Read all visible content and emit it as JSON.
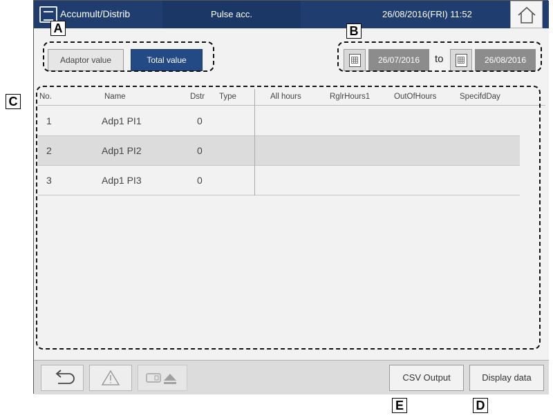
{
  "header": {
    "title": "Accumult/Distrib",
    "screen_name": "Pulse acc.",
    "datetime": "26/08/2016(FRI) 11:52"
  },
  "toggle": {
    "adaptor_label": "Adaptor value",
    "total_label": "Total value",
    "selected": "Total value"
  },
  "date_range": {
    "from": "26/07/2016",
    "separator": "to",
    "to": "26/08/2016"
  },
  "table": {
    "columns": [
      "No.",
      "Name",
      "Dstr",
      "Type",
      "All hours",
      "RglrHours1",
      "OutOfHours",
      "SpecifdDay"
    ],
    "rows": [
      {
        "no": "1",
        "name": "Adp1 PI1",
        "dstr": "0"
      },
      {
        "no": "2",
        "name": "Adp1 PI2",
        "dstr": "0"
      },
      {
        "no": "3",
        "name": "Adp1 PI3",
        "dstr": "0"
      }
    ]
  },
  "footer": {
    "csv_label": "CSV Output",
    "display_label": "Display data"
  },
  "markers": {
    "a": "A",
    "b": "B",
    "c": "C",
    "d": "D",
    "e": "E"
  },
  "icons": [
    "menu-icon",
    "home-icon",
    "calendar-icon",
    "back-icon",
    "warning-icon",
    "usb-eject-icon"
  ],
  "colors": {
    "header_bg": "#1f3d6e",
    "selected_toggle": "#234a85",
    "date_box": "#8c8c8c",
    "alt_row": "#dcdcdc"
  }
}
